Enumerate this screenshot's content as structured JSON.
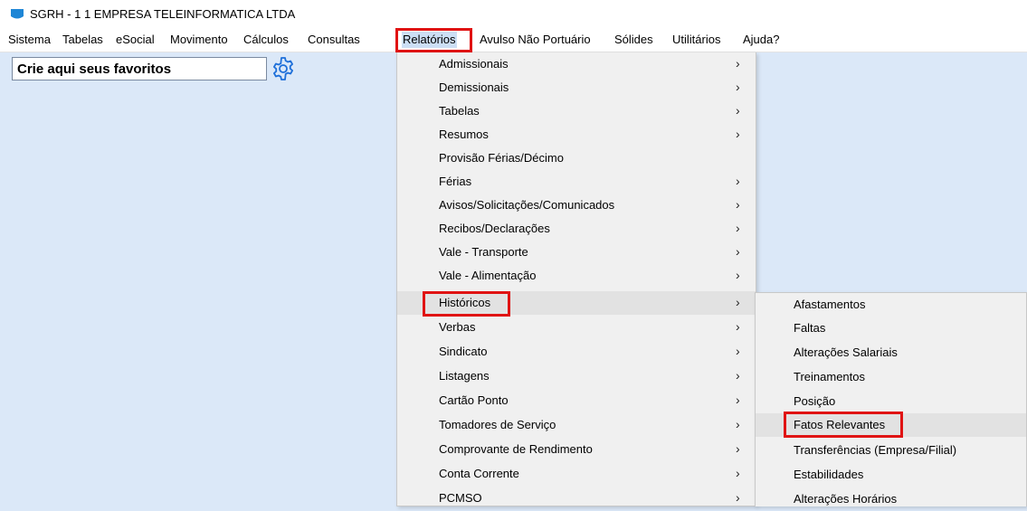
{
  "window": {
    "title": "SGRH - 1 1 EMPRESA TELEINFORMATICA LTDA"
  },
  "menubar": {
    "items": [
      {
        "label": "Sistema"
      },
      {
        "label": "Tabelas"
      },
      {
        "label": "eSocial"
      },
      {
        "label": "Movimento"
      },
      {
        "label": "Cálculos"
      },
      {
        "label": "Consultas"
      },
      {
        "label": "Relatórios"
      },
      {
        "label": "Avulso Não Portuário"
      },
      {
        "label": "Sólides"
      },
      {
        "label": "Utilitários"
      },
      {
        "label": "Ajuda?"
      }
    ]
  },
  "favorites": {
    "placeholder": "Crie aqui seus favoritos",
    "settings_icon": "gear-icon"
  },
  "relatorios_menu": {
    "items": [
      {
        "label": "Admissionais",
        "submenu": true
      },
      {
        "label": "Demissionais",
        "submenu": true
      },
      {
        "label": "Tabelas",
        "submenu": true
      },
      {
        "label": "Resumos",
        "submenu": true
      },
      {
        "label": "Provisão Férias/Décimo",
        "submenu": false
      },
      {
        "label": "Férias",
        "submenu": true
      },
      {
        "label": "Avisos/Solicitações/Comunicados",
        "submenu": true
      },
      {
        "label": "Recibos/Declarações",
        "submenu": true
      },
      {
        "label": "Vale - Transporte",
        "submenu": true
      },
      {
        "label": "Vale - Alimentação",
        "submenu": true
      },
      {
        "label": "Históricos",
        "submenu": true
      },
      {
        "label": "Verbas",
        "submenu": true
      },
      {
        "label": "Sindicato",
        "submenu": true
      },
      {
        "label": "Listagens",
        "submenu": true
      },
      {
        "label": "Cartão Ponto",
        "submenu": true
      },
      {
        "label": "Tomadores de Serviço",
        "submenu": true
      },
      {
        "label": "Comprovante de Rendimento",
        "submenu": true
      },
      {
        "label": "Conta Corrente",
        "submenu": true
      },
      {
        "label": "PCMSO",
        "submenu": true
      }
    ],
    "arrow_glyph": "›"
  },
  "historicos_submenu": {
    "items": [
      {
        "label": "Afastamentos"
      },
      {
        "label": "Faltas"
      },
      {
        "label": "Alterações Salariais"
      },
      {
        "label": "Treinamentos"
      },
      {
        "label": "Posição"
      },
      {
        "label": "Fatos Relevantes"
      },
      {
        "label": "Transferências (Empresa/Filial)"
      },
      {
        "label": "Estabilidades"
      },
      {
        "label": "Alterações Horários"
      }
    ]
  },
  "colors": {
    "desktop": "#dbe8f8",
    "highlight_box": "#e01313",
    "menu_bg": "#f0f0f0",
    "gear": "#1e6fd9"
  }
}
